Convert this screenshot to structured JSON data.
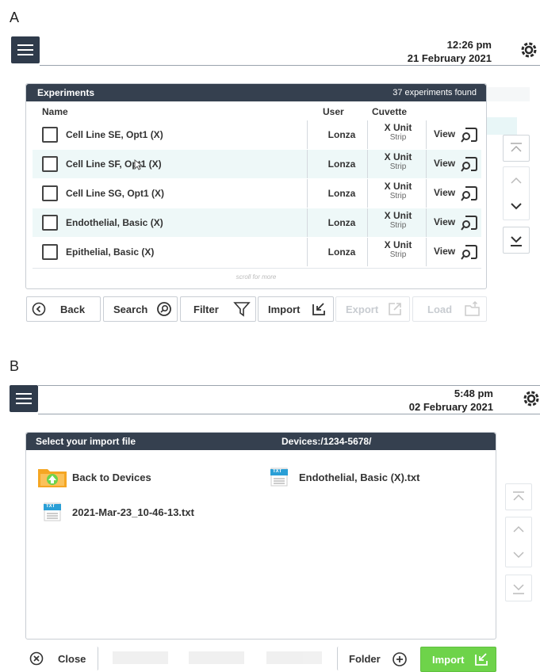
{
  "panel_a": {
    "letter": "A",
    "time": "12:26 pm",
    "date": "21 February 2021",
    "dialog_title": "Experiments",
    "found_count": "37 experiments found",
    "col_name": "Name",
    "col_user": "User",
    "col_cuvette": "Cuvette",
    "rows": [
      {
        "name": "Cell Line SE, Opt1 (X)",
        "user": "Lonza",
        "cuvette_unit": "X Unit",
        "cuvette_type": "Strip",
        "view": "View"
      },
      {
        "name": "Cell Line SF, Opt1 (X)",
        "user": "Lonza",
        "cuvette_unit": "X Unit",
        "cuvette_type": "Strip",
        "view": "View"
      },
      {
        "name": "Cell Line SG, Opt1 (X)",
        "user": "Lonza",
        "cuvette_unit": "X Unit",
        "cuvette_type": "Strip",
        "view": "View"
      },
      {
        "name": "Endothelial, Basic (X)",
        "user": "Lonza",
        "cuvette_unit": "X Unit",
        "cuvette_type": "Strip",
        "view": "View"
      },
      {
        "name": "Epithelial, Basic (X)",
        "user": "Lonza",
        "cuvette_unit": "X Unit",
        "cuvette_type": "Strip",
        "view": "View"
      }
    ],
    "scroll_hint": "scroll for more",
    "toolbar": {
      "back": "Back",
      "search": "Search",
      "filter": "Filter",
      "import": "Import",
      "export": "Export",
      "load": "Load"
    }
  },
  "panel_b": {
    "letter": "B",
    "time": "5:48 pm",
    "date": "02 February 2021",
    "dialog_title": "Select your import file",
    "path": "Devices:/1234-5678/",
    "items": {
      "back": "Back to Devices",
      "file1": "Endothelial, Basic (X).txt",
      "file2": "2021-Mar-23_10-46-13.txt"
    },
    "txt_badge": "TXT",
    "toolbar": {
      "close": "Close",
      "folder": "Folder",
      "import": "Import"
    }
  },
  "colors": {
    "header_dark": "#35404f",
    "import_green": "#6ed34a",
    "row_alt": "#eef8f8",
    "folder_orange": "#f5a623",
    "txt_blue": "#2a9fd6"
  }
}
